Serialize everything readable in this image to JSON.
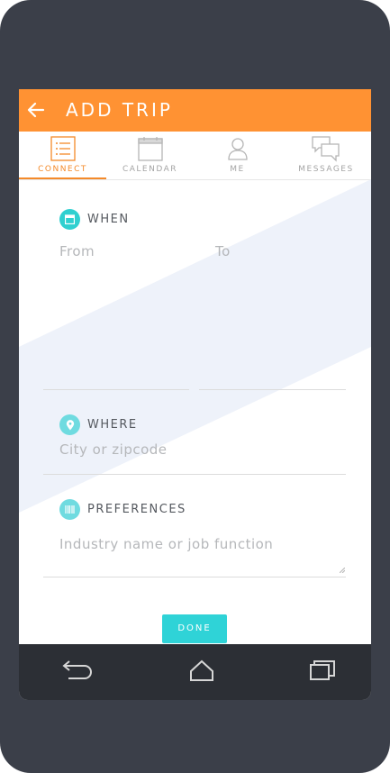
{
  "header": {
    "title": "ADD TRIP"
  },
  "tabs": [
    {
      "label": "CONNECT",
      "icon": "list-icon",
      "active": true
    },
    {
      "label": "CALENDAR",
      "icon": "calendar-icon",
      "active": false
    },
    {
      "label": "ME",
      "icon": "person-icon",
      "active": false
    },
    {
      "label": "MESSAGES",
      "icon": "chat-icon",
      "active": false
    }
  ],
  "when": {
    "title": "WHEN",
    "from_placeholder": "From",
    "to_placeholder": "To"
  },
  "where": {
    "title": "WHERE",
    "placeholder": "City or zipcode"
  },
  "preferences": {
    "title": "PREFERENCES",
    "placeholder": "Industry name or job function"
  },
  "done_label": "DONE",
  "colors": {
    "appbar": "#ff9233",
    "accent": "#f48a2a",
    "teal": "#2fd3d7",
    "frame": "#3b3f49",
    "navbar": "#2c2f35"
  }
}
